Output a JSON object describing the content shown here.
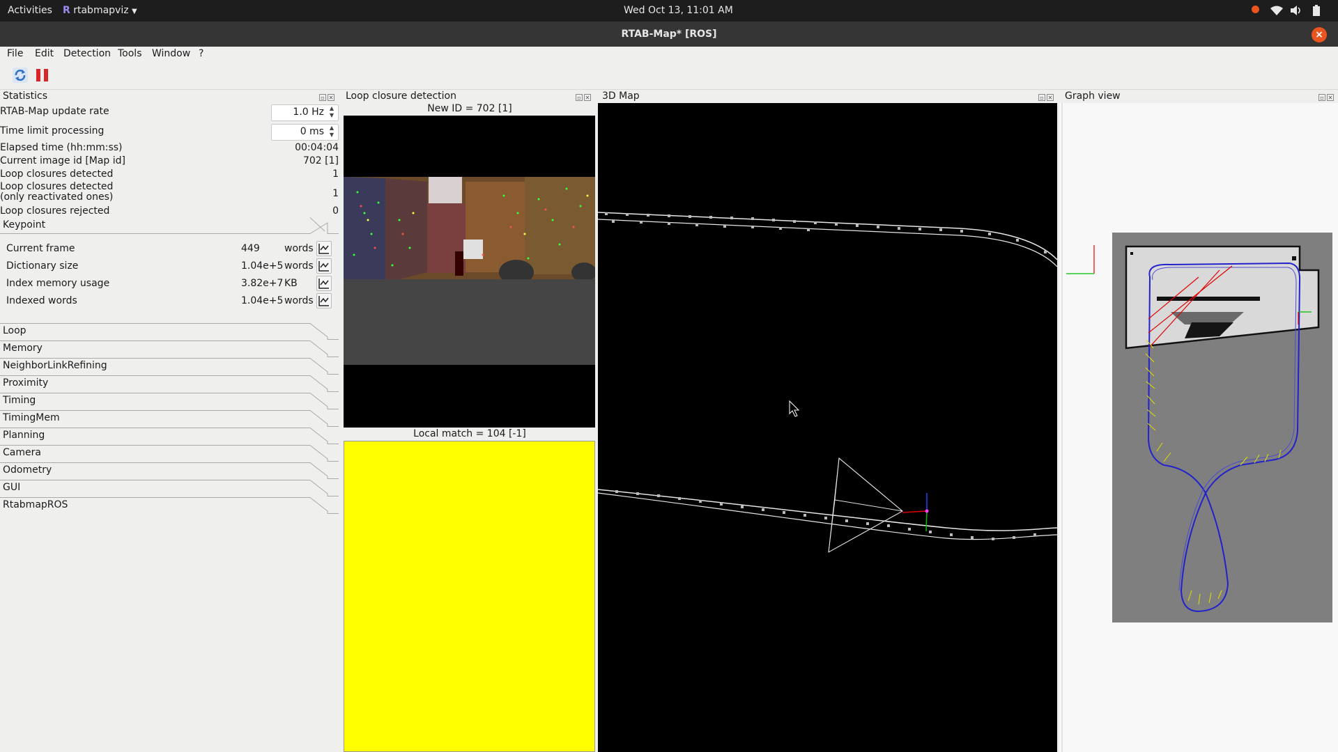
{
  "topbar": {
    "activities": "Activities",
    "app_name": "rtabmapviz",
    "clock": "Wed Oct 13, 11:01 AM"
  },
  "window": {
    "title": "RTAB-Map* [ROS]",
    "close_glyph": "×"
  },
  "menu": [
    "File",
    "Edit",
    "Detection",
    "Tools",
    "Window",
    "?"
  ],
  "toolbar": {
    "icons": [
      "refresh-icon",
      "pause-icon"
    ]
  },
  "docks": {
    "statistics": "Statistics",
    "loop_closure": "Loop closure detection",
    "map3d": "3D Map",
    "graph": "Graph view"
  },
  "statistics": {
    "update_rate": {
      "label": "RTAB-Map update rate",
      "value": "1.0 Hz"
    },
    "time_limit": {
      "label": "Time limit processing",
      "value": "0 ms"
    },
    "elapsed": {
      "label": "Elapsed time (hh:mm:ss)",
      "value": "00:04:04"
    },
    "current_image": {
      "label": "Current image id [Map id]",
      "value": "702 [1]"
    },
    "loop_detected": {
      "label": "Loop closures detected",
      "value": "1"
    },
    "loop_reactivated": {
      "label_line1": "Loop closures detected",
      "label_line2": "(only reactivated ones)",
      "value": "1"
    },
    "loop_rejected": {
      "label": "Loop closures rejected",
      "value": "0"
    },
    "keypoint": {
      "title": "Keypoint",
      "rows": [
        {
          "label": "Current frame",
          "value": "449",
          "unit": "words"
        },
        {
          "label": "Dictionary size",
          "value": "1.04e+5",
          "unit": "words"
        },
        {
          "label": "Index memory usage",
          "value": "3.82e+7",
          "unit": "KB"
        },
        {
          "label": "Indexed words",
          "value": "1.04e+5",
          "unit": "words"
        }
      ]
    },
    "sections": [
      "Loop",
      "Memory",
      "NeighborLinkRefining",
      "Proximity",
      "Timing",
      "TimingMem",
      "Planning",
      "Camera",
      "Odometry",
      "GUI",
      "RtabmapROS"
    ]
  },
  "loop_closure": {
    "new_id": "New ID = 702 [1]",
    "local_match": "Local match = 104 [-1]",
    "match_color": "#ffff00"
  },
  "colors": {
    "accent_close": "#e9541f",
    "map_bg": "#000000",
    "graph_path": "#2222cc",
    "loop_link": "#e00000"
  }
}
